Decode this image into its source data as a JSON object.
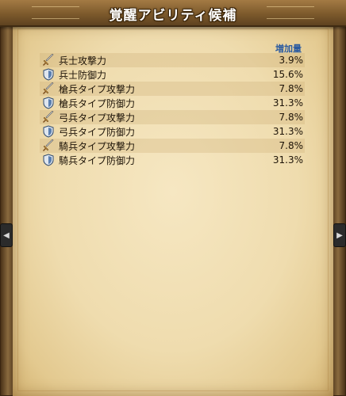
{
  "window": {
    "title": "覚醒アビリティ候補"
  },
  "table": {
    "value_header": "増加量",
    "rows": [
      {
        "name": "兵士攻撃力",
        "value": "3.9%",
        "icon": "sword-icon"
      },
      {
        "name": "兵士防御力",
        "value": "15.6%",
        "icon": "shield-icon"
      },
      {
        "name": "槍兵タイプ攻撃力",
        "value": "7.8%",
        "icon": "sword-icon"
      },
      {
        "name": "槍兵タイプ防御力",
        "value": "31.3%",
        "icon": "shield-icon"
      },
      {
        "name": "弓兵タイプ攻撃力",
        "value": "7.8%",
        "icon": "sword-icon"
      },
      {
        "name": "弓兵タイプ防御力",
        "value": "31.3%",
        "icon": "shield-icon"
      },
      {
        "name": "騎兵タイプ攻撃力",
        "value": "7.8%",
        "icon": "sword-icon"
      },
      {
        "name": "騎兵タイプ防御力",
        "value": "31.3%",
        "icon": "shield-icon"
      }
    ]
  },
  "colors": {
    "header_text": "#2a5aa0",
    "parchment": "#efdcae",
    "frame": "#6b4f2c"
  }
}
